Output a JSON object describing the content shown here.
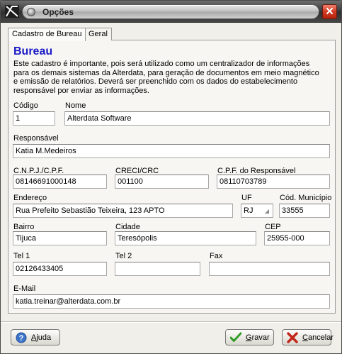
{
  "window": {
    "title": "Opções"
  },
  "tabs": [
    {
      "label": "Cadastro de Bureau"
    },
    {
      "label": "Geral"
    }
  ],
  "section": {
    "heading": "Bureau",
    "description": [
      "Este cadastro é importante, pois será utilizado como um centralizador de informações",
      "para os demais sistemas da Alterdata, para geração de documentos em meio magnético",
      "e emissão de relatórios. Deverá ser preenchido com os dados do estabelecimento",
      "responsável por enviar as informações."
    ]
  },
  "form": {
    "codigo": {
      "label": "Código",
      "value": "1"
    },
    "nome": {
      "label": "Nome",
      "value": "Alterdata Software"
    },
    "responsavel": {
      "label": "Responsável",
      "value": "Katia M.Medeiros"
    },
    "cnpj": {
      "label": "C.N.P.J./C.P.F.",
      "value": "08146691000148"
    },
    "creci": {
      "label": "CRECI/CRC",
      "value": "001100"
    },
    "cpf_resp": {
      "label": "C.P.F. do Responsável",
      "value": "08110703789"
    },
    "endereco": {
      "label": "Endereço",
      "value": "Rua Prefeito Sebastião Teixeira, 123 APTO"
    },
    "uf": {
      "label": "UF",
      "value": "RJ"
    },
    "cod_municipio": {
      "label": "Cód. Município",
      "value": "33555"
    },
    "bairro": {
      "label": "Bairro",
      "value": "Tijuca"
    },
    "cidade": {
      "label": "Cidade",
      "value": "Teresópolis"
    },
    "cep": {
      "label": "CEP",
      "value": "25955-000"
    },
    "tel1": {
      "label": "Tel 1",
      "value": "02126433405"
    },
    "tel2": {
      "label": "Tel 2",
      "value": ""
    },
    "fax": {
      "label": "Fax",
      "value": ""
    },
    "email": {
      "label": "E-Mail",
      "value": "katia.treinar@alterdata.com.br"
    }
  },
  "buttons": {
    "help": {
      "label_u": "A",
      "label_rest": "juda"
    },
    "save": {
      "label_u": "G",
      "label_rest": "ravar"
    },
    "cancel": {
      "label_u": "C",
      "label_rest": "ancelar"
    }
  },
  "colors": {
    "heading": "#1a1ac8",
    "save_check": "#2a9a1e",
    "cancel_x": "#c2261a",
    "close_button": "#d03a22"
  }
}
